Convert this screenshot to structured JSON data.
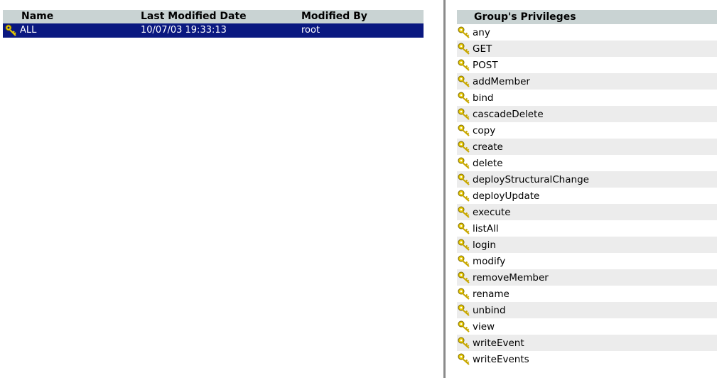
{
  "groups_table": {
    "columns": [
      "Name",
      "Last Modified Date",
      "Modified By"
    ],
    "rows": [
      {
        "name": "ALL",
        "last_modified": "10/07/03 19:33:13",
        "modified_by": "root",
        "selected": true
      }
    ]
  },
  "privileges": {
    "header": "Group's Privileges",
    "items": [
      "any",
      "GET",
      "POST",
      "addMember",
      "bind",
      "cascadeDelete",
      "copy",
      "create",
      "delete",
      "deployStructuralChange",
      "deployUpdate",
      "execute",
      "listAll",
      "login",
      "modify",
      "removeMember",
      "rename",
      "unbind",
      "view",
      "writeEvent",
      "writeEvents"
    ]
  },
  "colors": {
    "selected_row": "#0a1880",
    "header_bg": "#c9d3d3",
    "alt_row": "#ececec",
    "key_icon": "#d4b800"
  }
}
